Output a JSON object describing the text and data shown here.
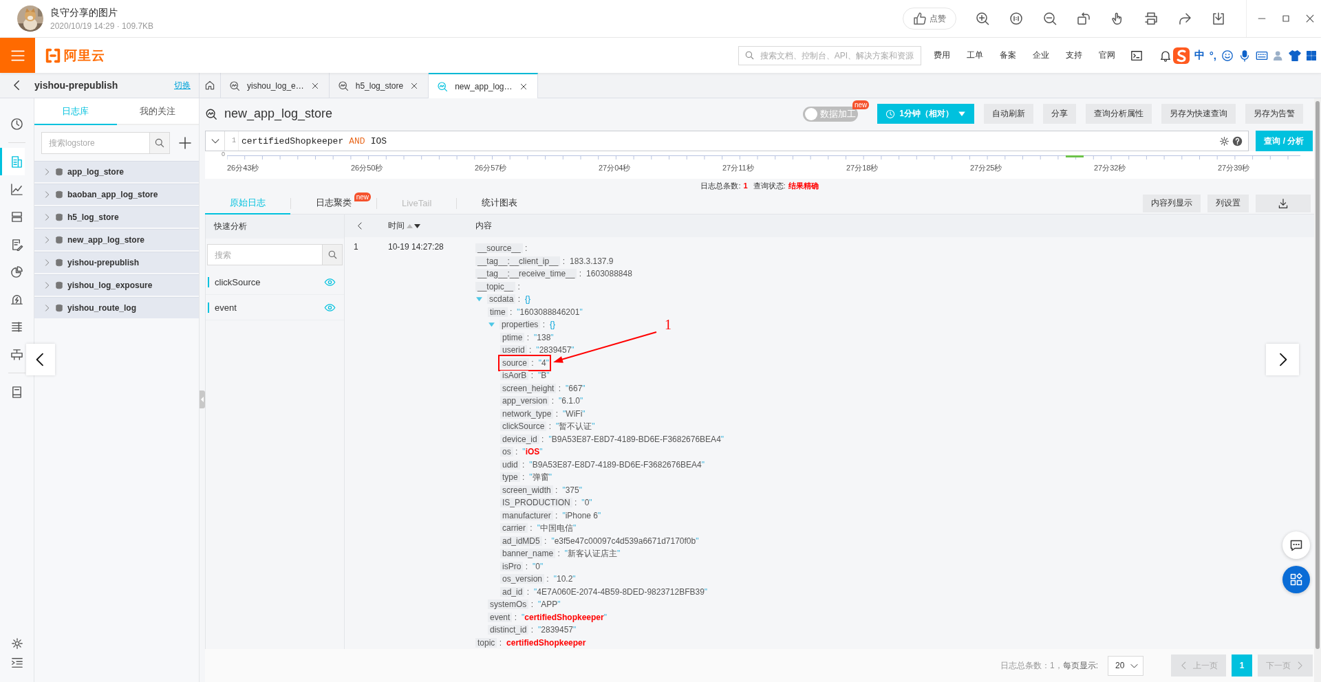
{
  "viewer": {
    "title": "良守分享的图片",
    "meta": "2020/10/19 14:29 · 109.7KB",
    "like_button": "点赞"
  },
  "topbar": {
    "brand": "阿里云",
    "search_placeholder": "搜索文档、控制台、API、解决方案和资源",
    "nav": [
      "费用",
      "工单",
      "备案",
      "企业",
      "支持",
      "官网"
    ],
    "ime": [
      "中",
      "°,"
    ]
  },
  "project": {
    "name": "yishou-prepublish",
    "switch_link": "切换"
  },
  "tabs": [
    {
      "label": "yishou_log_e…",
      "selected": false
    },
    {
      "label": "h5_log_store",
      "selected": false
    },
    {
      "label": "new_app_log…",
      "selected": true
    }
  ],
  "rail": [
    {
      "kind": "clock",
      "selected": false
    },
    {
      "kind": "logs",
      "selected": true
    },
    {
      "kind": "chart",
      "selected": false
    },
    {
      "kind": "storage",
      "selected": false
    },
    {
      "kind": "edit",
      "selected": false
    },
    {
      "kind": "pie",
      "selected": false
    },
    {
      "kind": "alarm",
      "selected": false
    },
    {
      "kind": "list",
      "selected": false
    },
    {
      "kind": "device",
      "selected": false
    },
    {
      "kind": "book",
      "selected": false
    }
  ],
  "sidebar": {
    "tabs": [
      {
        "label": "日志库",
        "selected": true
      },
      {
        "label": "我的关注",
        "selected": false
      }
    ],
    "search_placeholder": "搜索logstore",
    "items": [
      {
        "name": "app_log_store",
        "expanded": false
      },
      {
        "name": "baoban_app_log_store",
        "expanded": false
      },
      {
        "name": "h5_log_store",
        "expanded": false
      },
      {
        "name": "new_app_log_store",
        "expanded": false
      },
      {
        "name": "yishou-prepublish",
        "expanded": false
      },
      {
        "name": "yishou_log_exposure",
        "expanded": false
      },
      {
        "name": "yishou_route_log",
        "expanded": false
      }
    ]
  },
  "main": {
    "title": "new_app_log_store",
    "data_process": {
      "label": "数据加工",
      "on": false,
      "badge": "new"
    },
    "time_range": "1分钟（相对）",
    "buttons": [
      "自动刷新",
      "分享",
      "查询分析属性",
      "另存为快速查询",
      "另存为告警"
    ],
    "query": {
      "line": "1",
      "tokens": [
        {
          "text": "certifiedShopkeeper",
          "kind": "term"
        },
        {
          "text": "AND",
          "kind": "operator"
        },
        {
          "text": "IOS",
          "kind": "term"
        }
      ]
    },
    "search_button": "查询 / 分析"
  },
  "timeline": {
    "axis_label": "0",
    "labels": [
      "26分43秒",
      "26分50秒",
      "26分57秒",
      "27分04秒",
      "27分11秒",
      "27分18秒",
      "27分25秒",
      "27分32秒",
      "27分39秒"
    ]
  },
  "summary": {
    "count_label": "日志总条数:",
    "count": "1",
    "status_label": "查询状态:",
    "status": "结果精确"
  },
  "view_tabs": [
    {
      "label": "原始日志",
      "selected": true,
      "disabled": false
    },
    {
      "label": "日志聚类",
      "badge": "new",
      "selected": false,
      "disabled": false
    },
    {
      "label": "LiveTail",
      "selected": false,
      "disabled": true
    },
    {
      "label": "统计图表",
      "selected": false,
      "disabled": false
    }
  ],
  "view_buttons": [
    "内容列显示",
    "列设置"
  ],
  "quick_analysis": {
    "title": "快速分析",
    "search_placeholder": "搜索",
    "fields": [
      "clickSource",
      "event"
    ]
  },
  "log_table": {
    "columns": [
      "时间",
      "内容"
    ],
    "rows": [
      {
        "index": "1",
        "time": "10-19 14:27:28",
        "content": [
          {
            "key": "__source__ :",
            "kind": "text",
            "boxed": false
          },
          {
            "key": "__tag__:__client_ip__ :",
            "value": "183.3.137.9",
            "kind": "text",
            "highlight": false,
            "boxed": false
          },
          {
            "key": "__tag__:__receive_time__ :",
            "value": "1603088848",
            "kind": "text",
            "highlight": false,
            "boxed": false
          },
          {
            "key": "__topic__ :",
            "kind": "text",
            "boxed": false
          },
          {
            "key": "scdata :",
            "value": "{}",
            "kind": "object",
            "expanded": true,
            "highlight": false,
            "boxed": false,
            "children": [
              {
                "key": "time :",
                "value": "\"1603088846201\"",
                "kind": "string",
                "highlight": false,
                "boxed": false
              },
              {
                "key": "properties :",
                "value": "{}",
                "kind": "object",
                "expanded": true,
                "highlight": false,
                "boxed": false,
                "children": [
                  {
                    "key": "ptime :",
                    "value": "\"138\"",
                    "kind": "string",
                    "highlight": false,
                    "boxed": false
                  },
                  {
                    "key": "userid :",
                    "value": "\"2839457\"",
                    "kind": "string",
                    "highlight": false,
                    "boxed": false
                  },
                  {
                    "key": "source :",
                    "value": "\"4\"",
                    "kind": "string",
                    "highlight": false,
                    "boxed": true
                  },
                  {
                    "key": "isAorB :",
                    "value": "\"B\"",
                    "kind": "string",
                    "highlight": false,
                    "boxed": false
                  },
                  {
                    "key": "screen_height :",
                    "value": "\"667\"",
                    "kind": "string",
                    "highlight": false,
                    "boxed": false
                  },
                  {
                    "key": "app_version :",
                    "value": "\"6.1.0\"",
                    "kind": "string",
                    "highlight": false,
                    "boxed": false
                  },
                  {
                    "key": "network_type :",
                    "value": "\"WiFi\"",
                    "kind": "string",
                    "highlight": false,
                    "boxed": false
                  },
                  {
                    "key": "clickSource :",
                    "value": "\"暂不认证\"",
                    "kind": "string",
                    "highlight": false,
                    "boxed": false
                  },
                  {
                    "key": "device_id :",
                    "value": "\"B9A53E87-E8D7-4189-BD6E-F3682676BEA4\"",
                    "kind": "string",
                    "highlight": false,
                    "boxed": false
                  },
                  {
                    "key": "os :",
                    "value": "\"iOS\"",
                    "kind": "string",
                    "highlight": true,
                    "boxed": false
                  },
                  {
                    "key": "udid :",
                    "value": "\"B9A53E87-E8D7-4189-BD6E-F3682676BEA4\"",
                    "kind": "string",
                    "highlight": false,
                    "boxed": false
                  },
                  {
                    "key": "type :",
                    "value": "\"弹窗\"",
                    "kind": "string",
                    "highlight": false,
                    "boxed": false
                  },
                  {
                    "key": "screen_width :",
                    "value": "\"375\"",
                    "kind": "string",
                    "highlight": false,
                    "boxed": false
                  },
                  {
                    "key": "IS_PRODUCTION :",
                    "value": "\"0\"",
                    "kind": "string",
                    "highlight": false,
                    "boxed": false
                  },
                  {
                    "key": "manufacturer :",
                    "value": "\"iPhone 6\"",
                    "kind": "string",
                    "highlight": false,
                    "boxed": false
                  },
                  {
                    "key": "carrier :",
                    "value": "\"中国电信\"",
                    "kind": "string",
                    "highlight": false,
                    "boxed": false
                  },
                  {
                    "key": "ad_idMD5 :",
                    "value": "\"e3f5e47c00097c4d539a6671d7170f0b\"",
                    "kind": "string",
                    "highlight": false,
                    "boxed": false
                  },
                  {
                    "key": "banner_name :",
                    "value": "\"新客认证店主\"",
                    "kind": "string",
                    "highlight": false,
                    "boxed": false
                  },
                  {
                    "key": "isPro :",
                    "value": "\"0\"",
                    "kind": "string",
                    "highlight": false,
                    "boxed": false
                  },
                  {
                    "key": "os_version :",
                    "value": "\"10.2\"",
                    "kind": "string",
                    "highlight": false,
                    "boxed": false
                  },
                  {
                    "key": "ad_id :",
                    "value": "\"4E7A060E-2074-4B59-8DED-9823712BFB39\"",
                    "kind": "string",
                    "highlight": false,
                    "boxed": false
                  }
                ]
              },
              {
                "key": "systemOs :",
                "value": "\"APP\"",
                "kind": "string",
                "highlight": false,
                "boxed": false
              },
              {
                "key": "event :",
                "value": "\"certifiedShopkeeper\"",
                "kind": "string",
                "highlight": true,
                "boxed": false
              },
              {
                "key": "distinct_id :",
                "value": "\"2839457\"",
                "kind": "string",
                "highlight": false,
                "boxed": false
              }
            ]
          },
          {
            "key": "topic :",
            "value": "certifiedShopkeeper",
            "kind": "text",
            "highlight": true,
            "boxed": false
          }
        ]
      }
    ]
  },
  "annotation": {
    "label": "1"
  },
  "pagination": {
    "summary": "日志总条数：1，",
    "per_page_label": "每页显示:",
    "per_page": "20",
    "prev": "上一页",
    "next": "下一页",
    "pages": [
      {
        "label": "1",
        "selected": true
      }
    ]
  }
}
